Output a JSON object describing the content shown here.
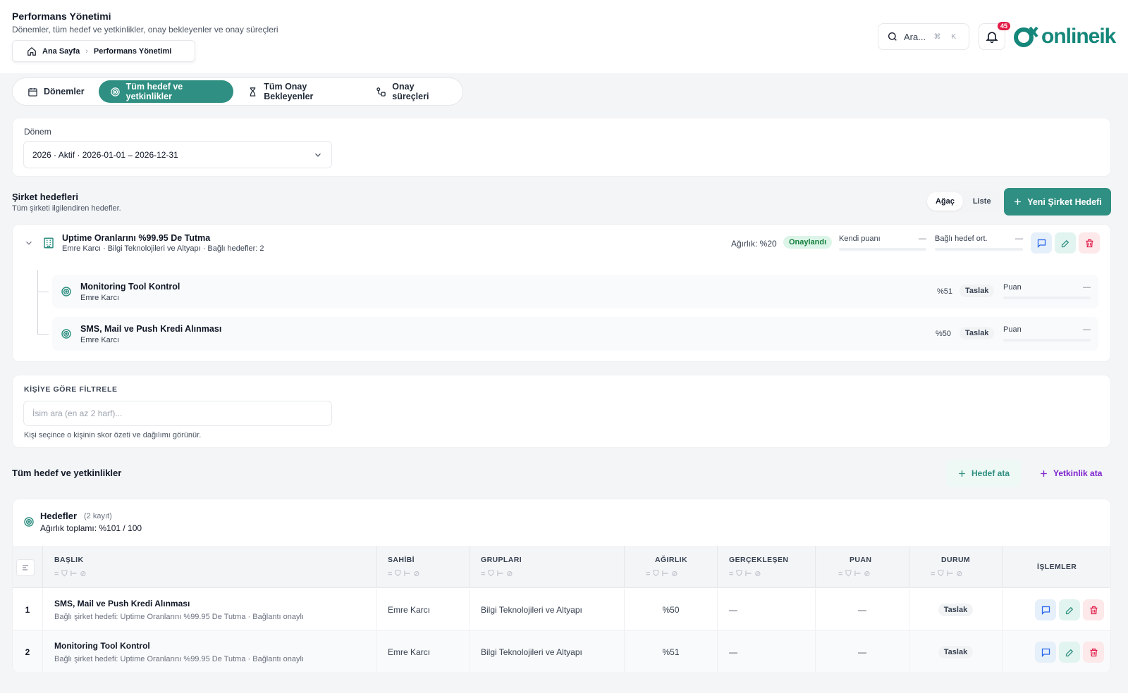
{
  "header": {
    "title": "Performans Yönetimi",
    "subtitle": "Dönemler, tüm hedef ve yetkinlikler, onay bekleyenler ve onay süreçleri",
    "breadcrumb": [
      "Ana Sayfa",
      "Performans Yönetimi"
    ],
    "search_label": "Ara...",
    "search_shortcut": "⌘ K",
    "notifications_count": "45",
    "logo_text": "onlineik"
  },
  "tabs": [
    {
      "label": "Dönemler",
      "icon": "calendar-icon"
    },
    {
      "label": "Tüm hedef ve yetkinlikler",
      "icon": "target-icon"
    },
    {
      "label": "Tüm Onay Bekleyenler",
      "icon": "hourglass-icon"
    },
    {
      "label": "Onay süreçleri",
      "icon": "workflow-icon"
    }
  ],
  "period": {
    "label": "Dönem",
    "value": "2026 · Aktif · 2026-01-01 – 2026-12-31"
  },
  "company_goals": {
    "title": "Şirket hedefleri",
    "subtitle": "Tüm şirketi ilgilendiren hedefler.",
    "view_tree": "Ağaç",
    "view_list": "Liste",
    "new_button": "Yeni Şirket Hedefi",
    "goal": {
      "title": "Uptime Oranlarını %99.95 De Tutma",
      "meta": "Emre Karcı · Bilgi Teknolojileri ve Altyapı · Bağlı hedefler: 2",
      "weight": "Ağırlık: %20",
      "status": "Onaylandı",
      "own_score_label": "Kendi puanı",
      "own_score_value": "—",
      "linked_avg_label": "Bağlı hedef ort.",
      "linked_avg_value": "—"
    },
    "children": [
      {
        "title": "Monitoring Tool Kontrol",
        "owner": "Emre Karcı",
        "weight": "%51",
        "status": "Taslak",
        "score_label": "Puan",
        "score_value": "—"
      },
      {
        "title": "SMS, Mail ve Push Kredi Alınması",
        "owner": "Emre Karcı",
        "weight": "%50",
        "status": "Taslak",
        "score_label": "Puan",
        "score_value": "—"
      }
    ]
  },
  "person_filter": {
    "title": "KİŞİYE GÖRE FİLTRELE",
    "placeholder": "İsim ara (en az 2 harf)...",
    "hint": "Kişi seçince o kişinin skor özeti ve dağılımı görünür."
  },
  "all_goals": {
    "title": "Tüm hedef ve yetkinlikler",
    "assign_goal": "Hedef ata",
    "assign_competency": "Yetkinlik ata"
  },
  "goals_table": {
    "title": "Hedefler",
    "count": "(2 kayıt)",
    "weight_total": "Ağırlık toplamı: %101 / 100",
    "columns": [
      "BAŞLIK",
      "SAHİBİ",
      "GRUPLARI",
      "AĞIRLIK",
      "GERÇEKLEŞEN",
      "PUAN",
      "DURUM",
      "İŞLEMLER"
    ],
    "rows": [
      {
        "no": "1",
        "title": "SMS, Mail ve Push Kredi Alınması",
        "sub": "Bağlı şirket hedefi: Uptime Oranlarını %99.95 De Tutma · Bağlantı onaylı",
        "owner": "Emre Karcı",
        "group": "Bilgi Teknolojileri ve Altyapı",
        "weight": "%50",
        "actual": "—",
        "score": "—",
        "status": "Taslak"
      },
      {
        "no": "2",
        "title": "Monitoring Tool Kontrol",
        "sub": "Bağlı şirket hedefi: Uptime Oranlarını %99.95 De Tutma · Bağlantı onaylı",
        "owner": "Emre Karcı",
        "group": "Bilgi Teknolojileri ve Altyapı",
        "weight": "%51",
        "actual": "—",
        "score": "—",
        "status": "Taslak"
      }
    ]
  },
  "colors": {
    "brand": "#2f8f82",
    "approved_bg": "#dcf5e8",
    "approved_text": "#15803d",
    "danger": "#e11d48",
    "purple": "#7e22ce"
  }
}
